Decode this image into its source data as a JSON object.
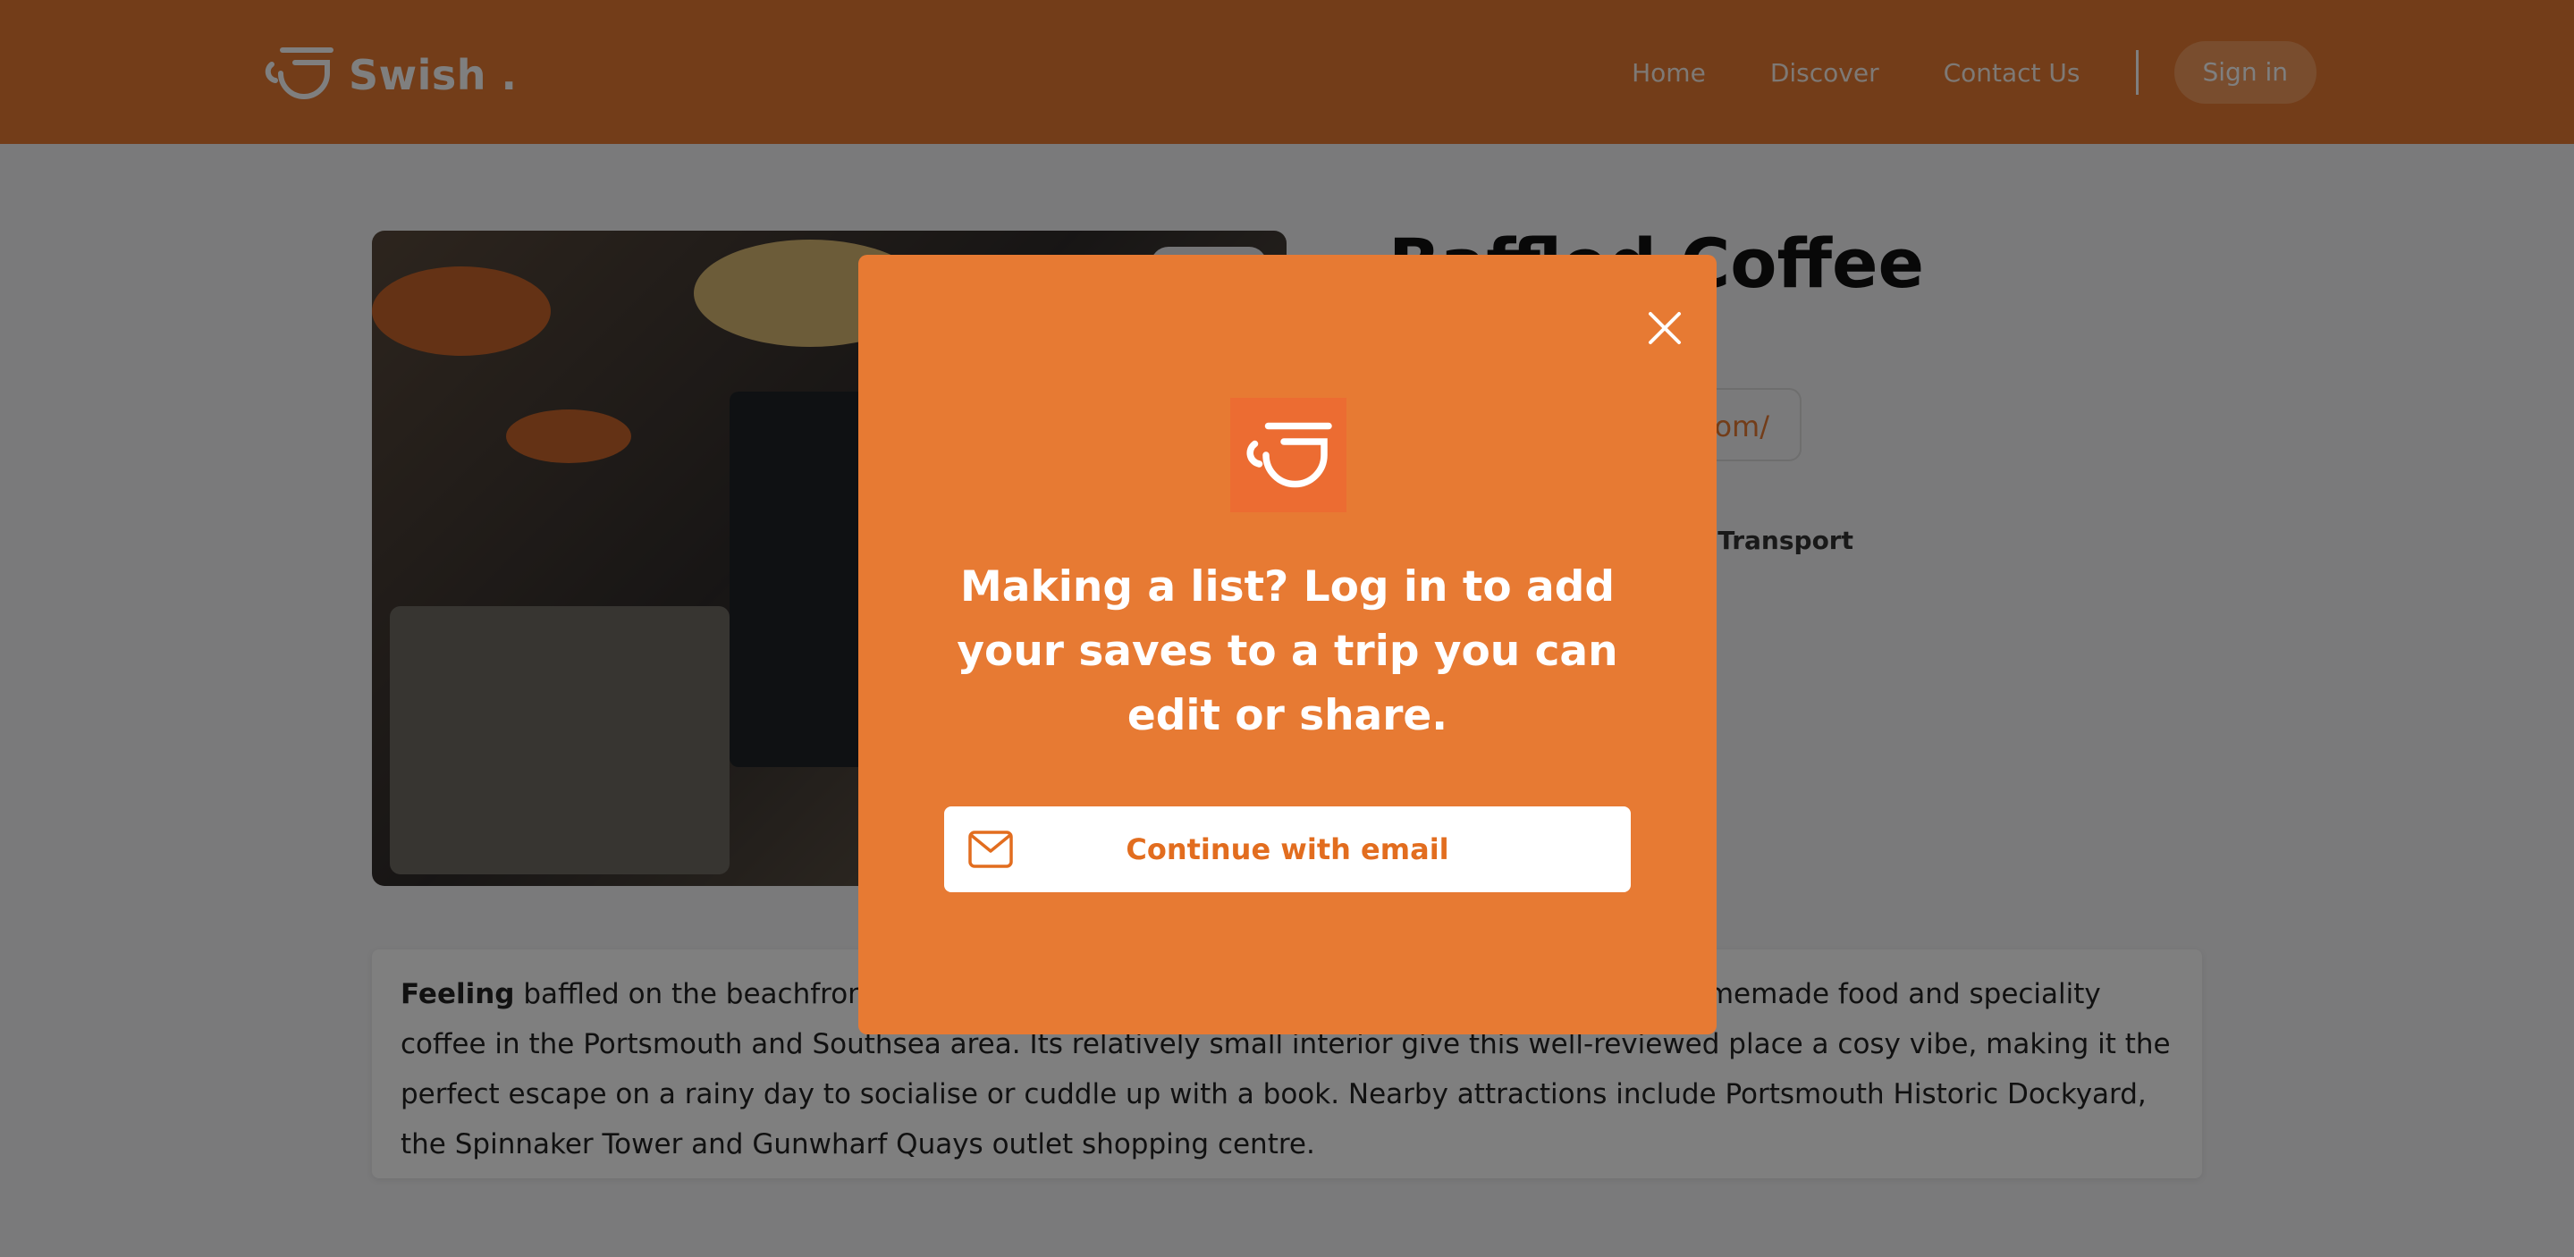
{
  "brand": {
    "name": "Swish .",
    "logo_icon": "cup-logo-icon",
    "color": "#e77a33"
  },
  "nav": {
    "items": [
      "Home",
      "Discover",
      "Contact Us"
    ],
    "signin": "Sign in"
  },
  "place": {
    "title": "Baffled Coffee",
    "website": "https://baffledcoffee.com/",
    "transport": "Public Transport",
    "description_lead": "Feeling",
    "description_rest": " baffled on the beachfront? Baffled Coffee is an independent cafe serving delicious homemade food and speciality coffee in the Portsmouth and Southsea area. Its relatively small interior give this well-reviewed place a cosy vibe, making it the perfect escape on a rainy day to socialise or cuddle up with a book. Nearby attractions include Portsmouth Historic Dockyard, the Spinnaker Tower and Gunwharf Quays outlet shopping centre."
  },
  "modal": {
    "message": "Making a list? Log in to add your saves to a trip you can edit or share.",
    "email_button": "Continue with email",
    "close_icon": "close-icon",
    "email_icon": "envelope-icon"
  }
}
